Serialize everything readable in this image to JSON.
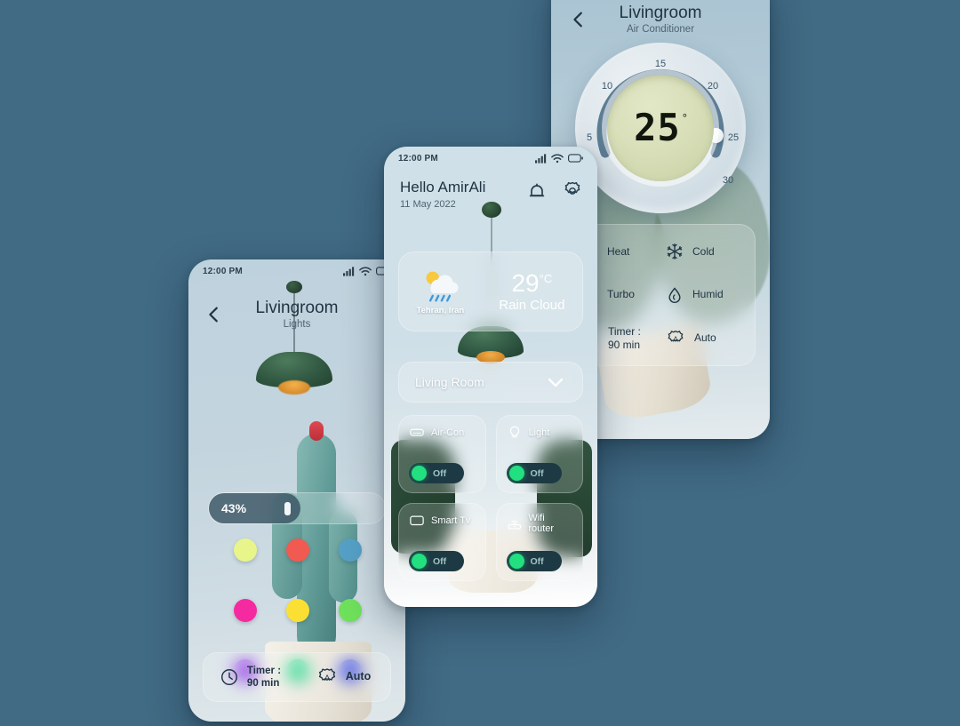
{
  "background_color": "#416a84",
  "lights_phone": {
    "status_bar": {
      "time": "12:00 PM",
      "signal_icon": "signal-bars-icon",
      "wifi_icon": "wifi-icon",
      "battery_icon": "battery-icon"
    },
    "nav": {
      "back_icon": "back-chevron-icon",
      "title": "Livingroom",
      "subtitle": "Lights"
    },
    "brightness": {
      "value_label": "43%",
      "percent": 43
    },
    "colors": [
      {
        "name": "pale-yellow",
        "hex": "#e8f58b"
      },
      {
        "name": "red",
        "hex": "#f05a50"
      },
      {
        "name": "steel-blue",
        "hex": "#55a0c6"
      },
      {
        "name": "magenta",
        "hex": "#f52aa0"
      },
      {
        "name": "yellow",
        "hex": "#fbe033"
      },
      {
        "name": "light-green",
        "hex": "#6fe05c"
      },
      {
        "name": "purple",
        "hex": "#8b2ae8"
      },
      {
        "name": "spring-green",
        "hex": "#1fd98a"
      },
      {
        "name": "blue",
        "hex": "#2a3fe8"
      }
    ],
    "bottom_bar": {
      "timer": {
        "icon": "clock-icon",
        "line1": "Timer :",
        "line2": "90 min"
      },
      "auto": {
        "icon": "auto-gear-icon",
        "label": "Auto"
      }
    }
  },
  "home_phone": {
    "status_bar": {
      "time": "12:00 PM",
      "signal_icon": "signal-bars-icon",
      "wifi_icon": "wifi-icon",
      "battery_icon": "battery-icon"
    },
    "header": {
      "greeting": "Hello AmirAli",
      "date": "11 May 2022",
      "bell_icon": "bell-icon",
      "settings_icon": "gear-icon"
    },
    "weather": {
      "icon": "sun-rain-cloud-icon",
      "city": "Tehran, Iran",
      "temperature": "29",
      "degree": "°C",
      "condition": "Rain Cloud"
    },
    "room_select": {
      "value": "Living Room",
      "chevron_icon": "chevron-down-icon"
    },
    "devices": [
      {
        "icon": "air-conditioner-icon",
        "label": "Air-Con",
        "state": "Off"
      },
      {
        "icon": "lightbulb-icon",
        "label": "Light",
        "state": "Off"
      },
      {
        "icon": "tv-icon",
        "label": "Smart Tv",
        "state": "Off"
      },
      {
        "icon": "wifi-router-icon",
        "label": "Wifi router",
        "state": "Off"
      }
    ]
  },
  "ac_phone": {
    "nav": {
      "back_icon": "back-chevron-icon",
      "title": "Livingroom",
      "subtitle": "Air Conditioner"
    },
    "dial": {
      "value": "25",
      "degree": "°",
      "ticks": [
        "5",
        "10",
        "15",
        "20",
        "25",
        "30"
      ],
      "min": 5,
      "max": 30,
      "current": 25
    },
    "modes": [
      {
        "icon": "sun-icon",
        "label": "Heat"
      },
      {
        "icon": "snowflake-icon",
        "label": "Cold"
      },
      {
        "icon": "wind-icon",
        "label": "Turbo"
      },
      {
        "icon": "droplet-icon",
        "label": "Humid"
      },
      {
        "icon": "clock-icon",
        "label": "Timer :",
        "label2": "90 min"
      },
      {
        "icon": "auto-gear-icon",
        "label": "Auto"
      }
    ]
  }
}
